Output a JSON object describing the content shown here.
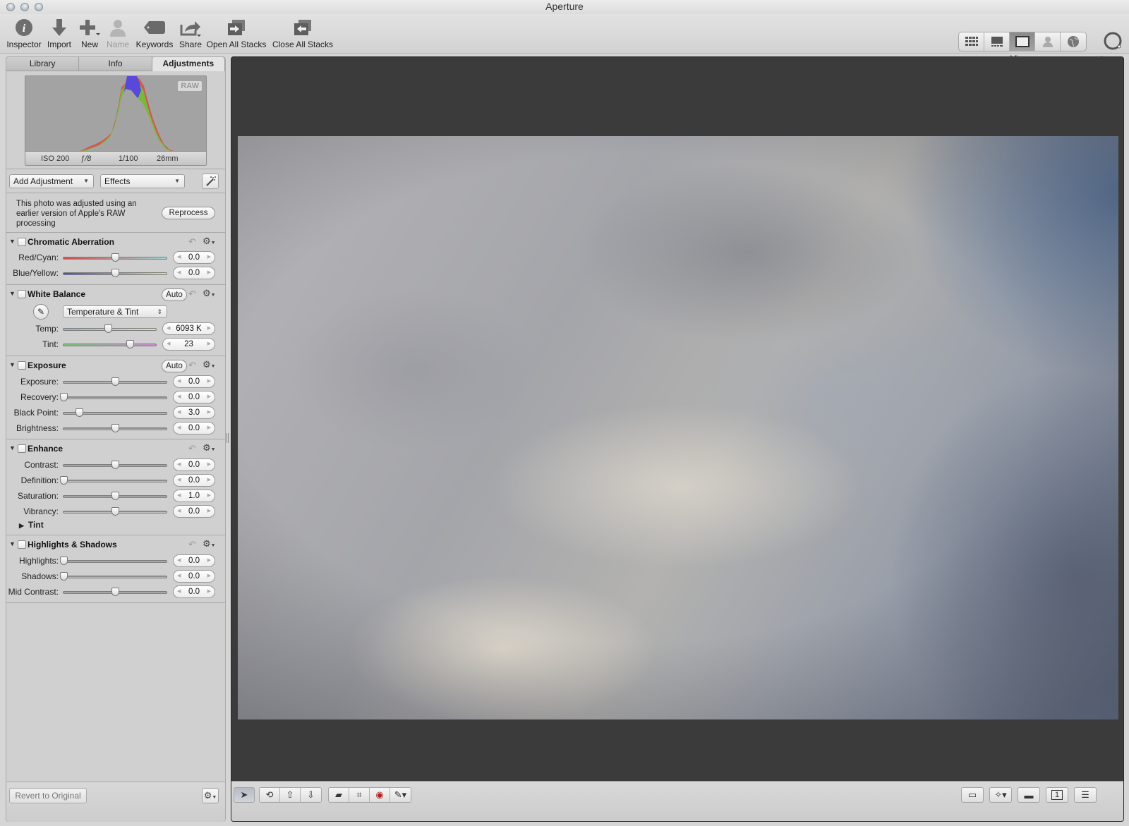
{
  "window": {
    "title": "Aperture"
  },
  "toolbar": {
    "inspector": "Inspector",
    "import": "Import",
    "new": "New",
    "name": "Name",
    "keywords": "Keywords",
    "share": "Share",
    "open_all_stacks": "Open All Stacks",
    "close_all_stacks": "Close All Stacks",
    "viewer": "Viewer",
    "loupe": "Loupe",
    "viewer_modes": [
      "browser-grid",
      "split-view",
      "viewer",
      "faces",
      "places"
    ],
    "viewer_mode_active": "viewer"
  },
  "inspector": {
    "tabs": [
      "Library",
      "Info",
      "Adjustments"
    ],
    "active_tab": "Adjustments",
    "histogram": {
      "badge": "RAW",
      "iso": "ISO 200",
      "aperture": "ƒ/8",
      "shutter": "1/100",
      "focal_length": "26mm"
    },
    "add_adjustment": "Add Adjustment",
    "effects": "Effects",
    "notice": "This photo was adjusted using an earlier version of Apple's RAW processing",
    "reprocess": "Reprocess",
    "sections": {
      "chromatic": {
        "name": "Chromatic Aberration",
        "rows": [
          {
            "label": "Red/Cyan:",
            "value": "0.0",
            "position": 0.5
          },
          {
            "label": "Blue/Yellow:",
            "value": "0.0",
            "position": 0.5
          }
        ]
      },
      "white_balance": {
        "name": "White Balance",
        "auto": "Auto",
        "mode": "Temperature & Tint",
        "rows": [
          {
            "label": "Temp:",
            "value": "6093 K",
            "position": 0.48
          },
          {
            "label": "Tint:",
            "value": "23",
            "position": 0.72
          }
        ]
      },
      "exposure": {
        "name": "Exposure",
        "auto": "Auto",
        "rows": [
          {
            "label": "Exposure:",
            "value": "0.0",
            "position": 0.5
          },
          {
            "label": "Recovery:",
            "value": "0.0",
            "position": 0.0
          },
          {
            "label": "Black Point:",
            "value": "3.0",
            "position": 0.15
          },
          {
            "label": "Brightness:",
            "value": "0.0",
            "position": 0.5
          }
        ]
      },
      "enhance": {
        "name": "Enhance",
        "rows": [
          {
            "label": "Contrast:",
            "value": "0.0",
            "position": 0.5
          },
          {
            "label": "Definition:",
            "value": "0.0",
            "position": 0.0
          },
          {
            "label": "Saturation:",
            "value": "1.0",
            "position": 0.5
          },
          {
            "label": "Vibrancy:",
            "value": "0.0",
            "position": 0.5
          }
        ],
        "sub": "Tint"
      },
      "highlights": {
        "name": "Highlights & Shadows",
        "rows": [
          {
            "label": "Highlights:",
            "value": "0.0",
            "position": 0.0
          },
          {
            "label": "Shadows:",
            "value": "0.0",
            "position": 0.0
          },
          {
            "label": "Mid Contrast:",
            "value": "0.0",
            "position": 0.5
          }
        ]
      }
    },
    "revert": "Revert to Original"
  },
  "icons": {
    "undo": "↶",
    "gear": "⚙",
    "triangle_down": "▼",
    "triangle_right": "▶",
    "popup_arrow": "▼",
    "stepper_left": "◀",
    "stepper_right": "▶",
    "eyedropper": "✎",
    "pointer": "➤"
  }
}
